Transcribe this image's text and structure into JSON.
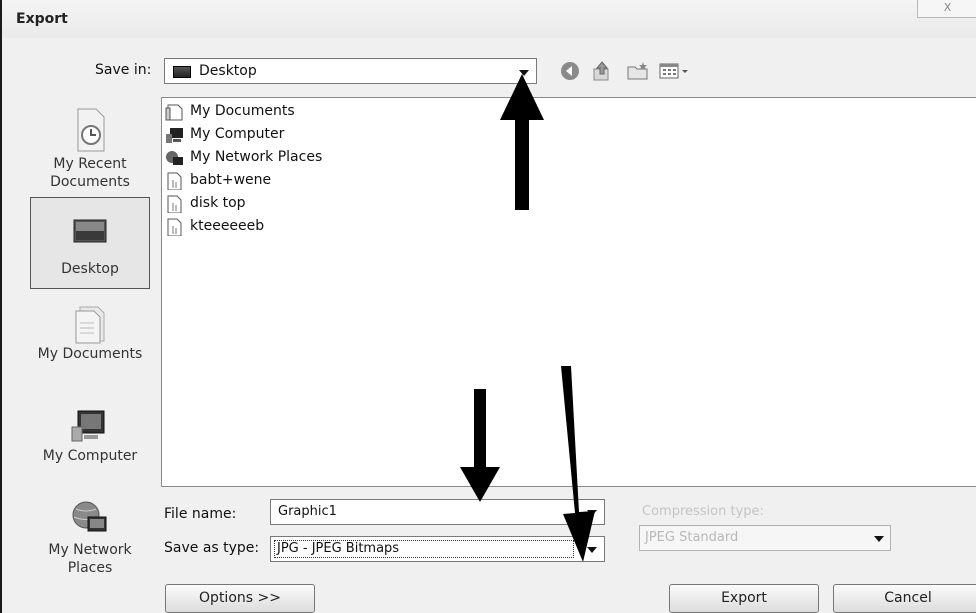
{
  "dialog": {
    "title": "Export",
    "close_glyph": "X"
  },
  "toolbar": {
    "save_in_label": "Save in:",
    "save_in_value": "Desktop",
    "back_icon": "back-icon",
    "up_icon": "up-folder-icon",
    "new_folder_icon": "new-folder-icon",
    "views_icon": "views-menu-icon"
  },
  "places": [
    {
      "label_lines": [
        "My Recent",
        "Documents"
      ],
      "icon": "recent-documents-icon",
      "selected": false
    },
    {
      "label_lines": [
        "Desktop"
      ],
      "icon": "desktop-icon",
      "selected": true
    },
    {
      "label_lines": [
        "My Documents"
      ],
      "icon": "my-documents-icon",
      "selected": false
    },
    {
      "label_lines": [
        "My Computer"
      ],
      "icon": "my-computer-icon",
      "selected": false
    },
    {
      "label_lines": [
        "My Network",
        "Places"
      ],
      "icon": "network-places-icon",
      "selected": false
    }
  ],
  "files": [
    {
      "name": "My Documents",
      "icon": "documents-folder-icon"
    },
    {
      "name": "My Computer",
      "icon": "computer-icon"
    },
    {
      "name": "My Network Places",
      "icon": "network-icon"
    },
    {
      "name": "babt+wene",
      "icon": "file-icon"
    },
    {
      "name": "disk top",
      "icon": "file-icon"
    },
    {
      "name": "kteeeeeeb",
      "icon": "file-icon"
    }
  ],
  "form": {
    "file_name_label": "File name:",
    "file_name_value": "Graphic1",
    "save_as_type_label": "Save as type:",
    "save_as_type_value": "JPG - JPEG Bitmaps",
    "compression_label": "Compression type:",
    "compression_value": "JPEG Standard"
  },
  "buttons": {
    "options": "Options >>",
    "export": "Export",
    "cancel": "Cancel"
  },
  "annotations": {
    "arrow_color": "#000000",
    "count": 3
  }
}
